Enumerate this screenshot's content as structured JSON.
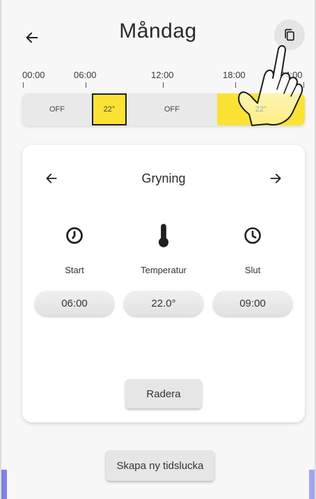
{
  "header": {
    "title": "Måndag",
    "back_icon": "arrow-left-icon",
    "copy_icon": "copy-icon"
  },
  "timeline": {
    "tick_labels": [
      "00:00",
      "06:00",
      "12:00",
      "18:00",
      "24:00"
    ],
    "segments": [
      {
        "label": "OFF",
        "state": "off",
        "start": "00:00",
        "end": "06:00"
      },
      {
        "label": "22°",
        "state": "on",
        "selected": true,
        "start": "06:00",
        "end": "09:00"
      },
      {
        "label": "OFF",
        "state": "off",
        "start": "09:00",
        "end": "18:00"
      },
      {
        "label": "22°",
        "state": "on",
        "start": "18:00",
        "end": "24:00"
      }
    ],
    "colors": {
      "on": "#fbe234",
      "off": "#e9e9e9"
    }
  },
  "card": {
    "period_name": "Gryning",
    "prev_icon": "arrow-left-icon",
    "next_icon": "arrow-right-icon",
    "start": {
      "label": "Start",
      "value": "06:00",
      "icon": "clock-start-icon"
    },
    "temperature": {
      "label": "Temperatur",
      "value": "22.0°",
      "icon": "thermometer-icon"
    },
    "end": {
      "label": "Slut",
      "value": "09:00",
      "icon": "clock-end-icon"
    },
    "delete_label": "Radera"
  },
  "footer": {
    "new_slot_label": "Skapa ny tidslucka"
  }
}
